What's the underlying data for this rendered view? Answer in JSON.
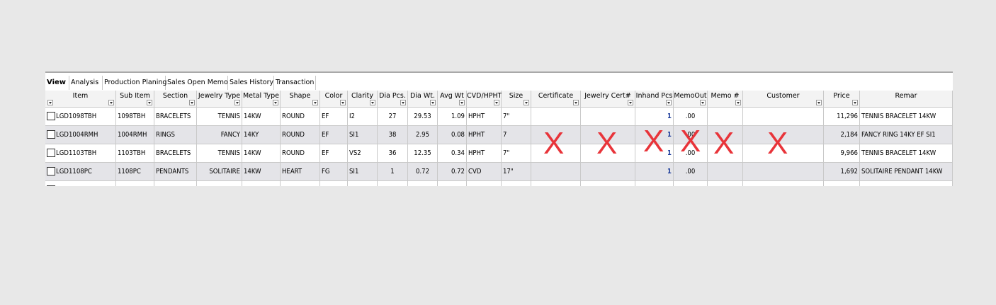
{
  "tabs": [
    "View",
    "Analysis",
    "Production Planing",
    "Sales Open Memo",
    "Sales History",
    "Transaction"
  ],
  "columns": [
    "Item",
    "Sub Item",
    "Section",
    "Jewelry Type",
    "Metal Type",
    "Shape",
    "Color",
    "Clarity",
    "Dia Pcs.",
    "Dia Wt.",
    "Avg Wt",
    "CVD/HPHT",
    "Size",
    "Certificate",
    "Jewelry Cert#",
    "Inhand Pcs",
    "MemoOut",
    "Memo #",
    "Customer",
    "Price",
    "Remar"
  ],
  "rows": [
    [
      "LGD1098TBH",
      "1098TBH",
      "BRACELETS",
      "TENNIS",
      "14KW",
      "ROUND",
      "EF",
      "I2",
      "27",
      "29.53",
      "1.09",
      "HPHT",
      "7\"",
      "",
      "",
      "1",
      ".00",
      "",
      "",
      "11,296",
      "TENNIS BRACELET 14KW"
    ],
    [
      "LGD1004RMH",
      "1004RMH",
      "RINGS",
      "FANCY",
      "14KY",
      "ROUND",
      "EF",
      "SI1",
      "38",
      "2.95",
      "0.08",
      "HPHT",
      "7",
      "",
      "",
      "1",
      ".00",
      "",
      "",
      "2,184",
      "FANCY RING 14KY EF SI1"
    ],
    [
      "LGD1103TBH",
      "1103TBH",
      "BRACELETS",
      "TENNIS",
      "14KW",
      "ROUND",
      "EF",
      "VS2",
      "36",
      "12.35",
      "0.34",
      "HPHT",
      "7\"",
      "",
      "",
      "1",
      ".00",
      "",
      "",
      "9,966",
      "TENNIS BRACELET 14KW"
    ],
    [
      "LGD1108PC",
      "1108PC",
      "PENDANTS",
      "SOLITAIRE",
      "14KW",
      "HEART",
      "FG",
      "SI1",
      "1",
      "0.72",
      "0.72",
      "CVD",
      "17\"",
      "",
      "",
      "1",
      ".00",
      "",
      "",
      "1,692",
      "SOLITAIRE PENDANT 14KW"
    ]
  ],
  "annotations": {
    "mark": "X",
    "color": "#e8343a"
  }
}
